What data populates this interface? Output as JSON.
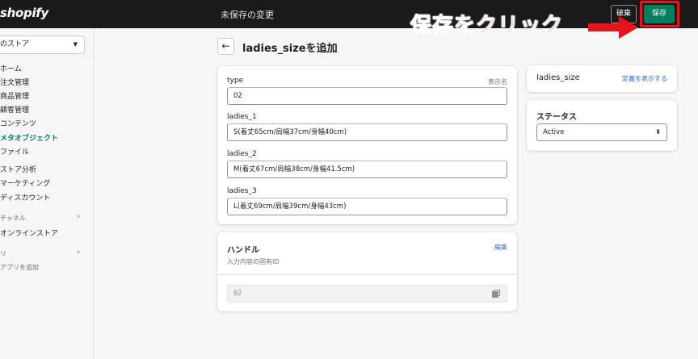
{
  "topbar": {
    "logo": "shopify",
    "unsaved_message": "未保存の変更",
    "discard_label": "破棄",
    "save_label": "保存"
  },
  "annotation": {
    "text": "保存をクリック",
    "color": "#e8141b"
  },
  "sidebar": {
    "store_name": "のストア",
    "items": [
      {
        "label": "ホーム"
      },
      {
        "label": "注文管理"
      },
      {
        "label": "商品管理"
      },
      {
        "label": "顧客管理"
      },
      {
        "label": "コンテンツ"
      },
      {
        "label": "メタオブジェクト",
        "active": true
      },
      {
        "label": "ファイル"
      },
      {
        "label": "ストア分析"
      },
      {
        "label": "マーケティング"
      },
      {
        "label": "ディスカウント"
      }
    ],
    "sales_channels_label": "チャネル",
    "online_store_label": "オンラインストア",
    "apps_label": "リ",
    "add_app_label": "アプリを追加"
  },
  "page": {
    "title": "ladies_sizeを追加"
  },
  "fields_card": {
    "fields": [
      {
        "label": "type",
        "hint": "表示名",
        "value": "02"
      },
      {
        "label": "ladies_1",
        "value": "S(着丈65cm/肩幅37cm/身幅40cm)"
      },
      {
        "label": "ladies_2",
        "value": "M(着丈67cm/肩幅38cm/身幅41.5cm)"
      },
      {
        "label": "ladies_3",
        "value": "L(着丈69cm/肩幅39cm/身幅43cm)"
      }
    ]
  },
  "handle_card": {
    "heading": "ハンドル",
    "edit_label": "編集",
    "description": "入力内容の固有ID",
    "value": "02"
  },
  "definition_card": {
    "name": "ladies_size",
    "link_label": "定義を表示する"
  },
  "status_card": {
    "heading": "ステータス",
    "selected": "Active"
  },
  "colors": {
    "save_button": "#008060",
    "link": "#2c6ecb",
    "active_nav": "#007f5f"
  }
}
